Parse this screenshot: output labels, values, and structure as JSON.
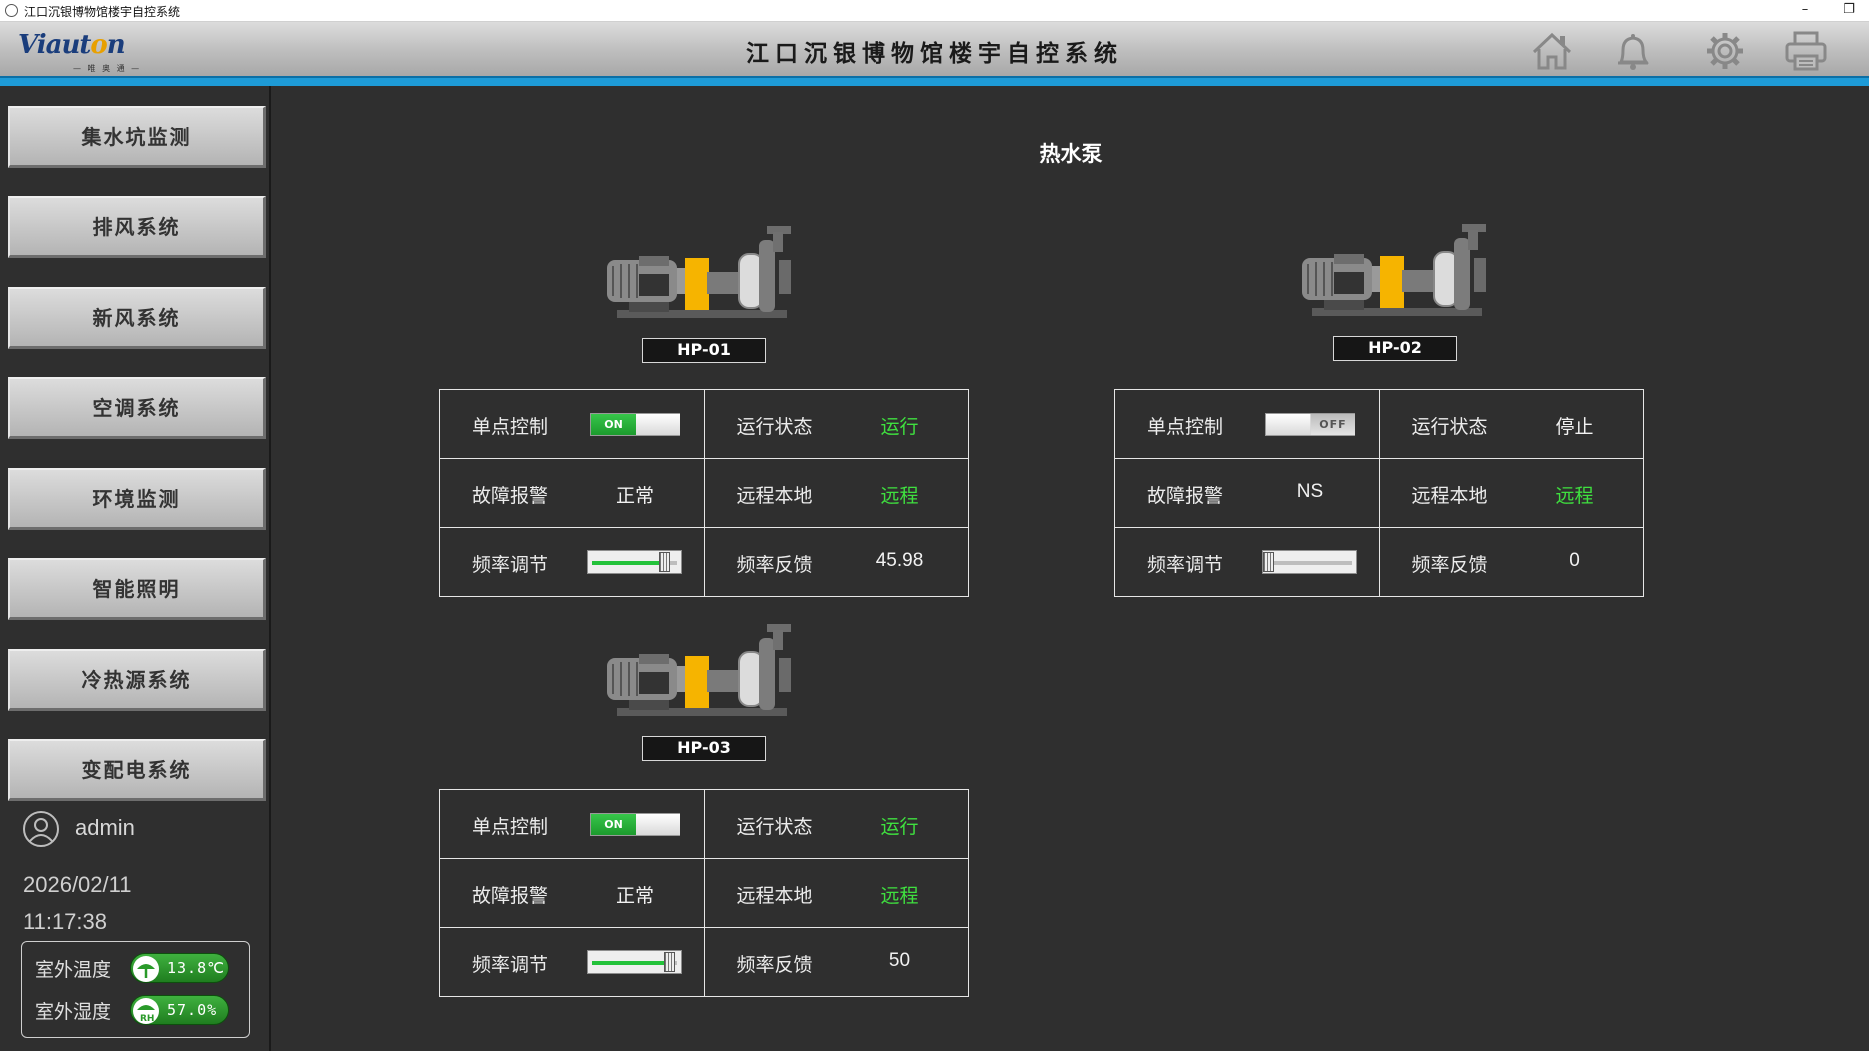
{
  "window": {
    "title": "江口沉银博物馆楼宇自控系统",
    "minimize": "–",
    "restore": "❐"
  },
  "header": {
    "logo_main_a": "Viaut",
    "logo_main_b": "o",
    "logo_main_c": "n",
    "logo_sub": "— 唯 奥 通 —",
    "title": "江口沉银博物馆楼宇自控系统",
    "icons": [
      "home-icon",
      "bell-icon",
      "gear-icon",
      "printer-icon"
    ],
    "accent_color": "#1e9bd7"
  },
  "sidebar": {
    "items": [
      {
        "label": "集水坑监测"
      },
      {
        "label": "排风系统"
      },
      {
        "label": "新风系统"
      },
      {
        "label": "空调系统"
      },
      {
        "label": "环境监测"
      },
      {
        "label": "智能照明"
      },
      {
        "label": "冷热源系统"
      },
      {
        "label": "变配电系统"
      }
    ],
    "user": "admin",
    "date": "2026/02/11",
    "time": "11:17:38",
    "weather": {
      "temp_label": "室外温度",
      "temp_value": "13.8℃",
      "hum_label": "室外湿度",
      "hum_value": "57.0%",
      "hum_icon_text": "RH"
    }
  },
  "main": {
    "title": "热水泵",
    "pumps": [
      {
        "name": "HP-01",
        "labels": {
          "control": "单点控制",
          "run_state": "运行状态",
          "fault": "故障报警",
          "remote_local": "远程本地",
          "freq_set": "频率调节",
          "freq_fb": "频率反馈"
        },
        "control_switch": "ON",
        "run_state": "运行",
        "fault": "正常",
        "remote_local": "远程",
        "freq_setpoint_fraction": 0.93,
        "freq_feedback": "45.98"
      },
      {
        "name": "HP-02",
        "labels": {
          "control": "单点控制",
          "run_state": "运行状态",
          "fault": "故障报警",
          "remote_local": "远程本地",
          "freq_set": "频率调节",
          "freq_fb": "频率反馈"
        },
        "control_switch": "OFF",
        "run_state": "停止",
        "fault": "NS",
        "remote_local": "远程",
        "freq_setpoint_fraction": 0.0,
        "freq_feedback": "0"
      },
      {
        "name": "HP-03",
        "labels": {
          "control": "单点控制",
          "run_state": "运行状态",
          "fault": "故障报警",
          "remote_local": "远程本地",
          "freq_set": "频率调节",
          "freq_fb": "频率反馈"
        },
        "control_switch": "ON",
        "run_state": "运行",
        "fault": "正常",
        "remote_local": "远程",
        "freq_setpoint_fraction": 1.0,
        "freq_feedback": "50"
      }
    ],
    "status_colors": {
      "running": "#3fe03f",
      "remote": "#3fe03f",
      "normal": "#f2f2f2"
    }
  }
}
